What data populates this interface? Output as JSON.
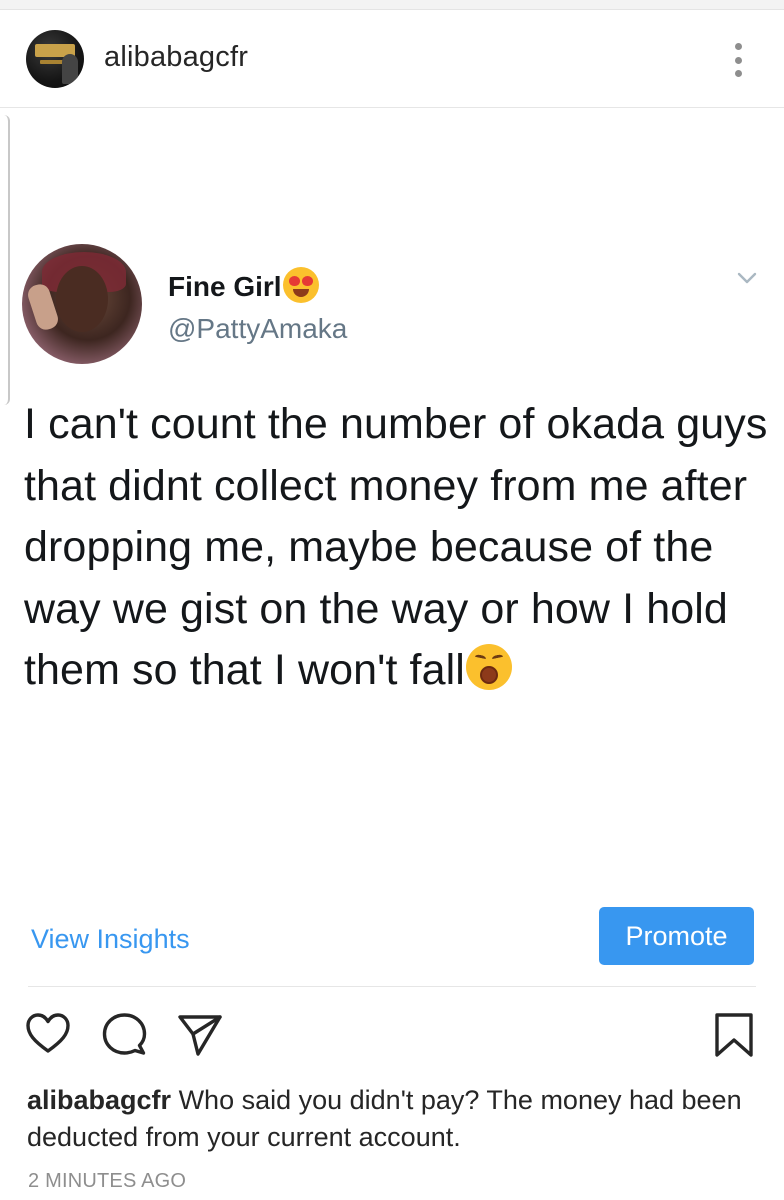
{
  "post": {
    "username": "alibabagcfr",
    "more_icon": "more-vertical-icon"
  },
  "tweet": {
    "display_name": "Fine Girl",
    "name_emoji": "heart-eyes-emoji",
    "handle": "@PattyAmaka",
    "text": "I can't count the number of okada guys that didnt collect money from me after dropping me, maybe because of the way we gist on the way or how I hold them so that I won't fall",
    "text_emoji": "tired-face-emoji"
  },
  "insights": {
    "view_insights_label": "View Insights",
    "promote_label": "Promote"
  },
  "actions": {
    "icons": [
      "heart-icon",
      "comment-icon",
      "share-icon",
      "bookmark-icon"
    ]
  },
  "caption": {
    "username": "alibabagcfr",
    "text": "Who said you didn't pay? The money had been deducted from your current account."
  },
  "timestamp": "2 MINUTES AGO",
  "colors": {
    "accent": "#3897f0",
    "text": "#262626",
    "muted": "#8e8e8e",
    "tweet_handle": "#657786"
  }
}
